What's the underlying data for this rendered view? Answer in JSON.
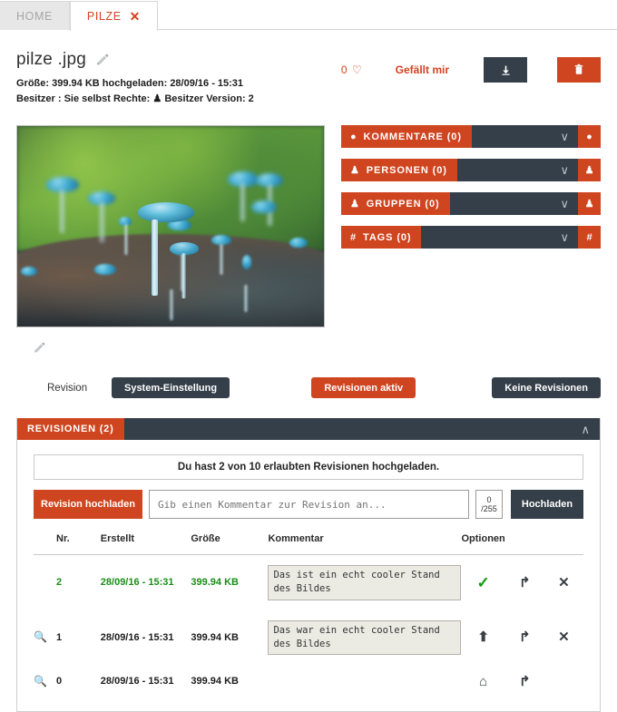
{
  "tabs": [
    {
      "label": "HOME",
      "active": false
    },
    {
      "label": "PILZE",
      "active": true,
      "close": "✕"
    }
  ],
  "file": {
    "title": "pilze .jpg",
    "meta_line1": "Größe: 399.94 KB  hochgeladen: 28/09/16 - 15:31",
    "meta_line2_a": "Besitzer : Sie selbst   Rechte:",
    "meta_line2_b": "Besitzer   Version: 2",
    "edit_icon": "pencil-icon"
  },
  "actions": {
    "like_count": "0",
    "heart_icon": "♡",
    "like_label": "Gefällt mir",
    "download_icon": "⬇",
    "delete_icon": "🗑"
  },
  "panels": [
    {
      "title": "KOMMENTARE (0)",
      "icon": "●",
      "icon_name": "comment-icon",
      "action_icon": "●",
      "chevron": "∨"
    },
    {
      "title": "PERSONEN (0)",
      "icon": "♟",
      "icon_name": "person-icon",
      "action_icon": "♟",
      "chevron": "∨"
    },
    {
      "title": "GRUPPEN (0)",
      "icon": "♟",
      "icon_name": "group-icon",
      "action_icon": "♟",
      "chevron": "∨"
    },
    {
      "title": "TAGS (0)",
      "icon": "#",
      "icon_name": "hash-icon",
      "action_icon": "#",
      "chevron": "∨"
    }
  ],
  "revision_settings": {
    "label": "Revision",
    "system_btn": "System-Einstellung",
    "active_btn": "Revisionen aktiv",
    "none_btn": "Keine Revisionen"
  },
  "revisions": {
    "header": "REVISIONEN (2)",
    "collapse_icon": "∧",
    "notice": "Du hast 2 von 10 erlaubten Revisionen hochgeladen.",
    "upload_btn": "Revision hochladen",
    "comment_placeholder": "Gib einen Kommentar zur Revision an...",
    "counter_current": "0",
    "counter_max": "/255",
    "submit_btn": "Hochladen",
    "columns": [
      "Nr.",
      "Erstellt",
      "Größe",
      "Kommentar",
      "Optionen"
    ],
    "rows": [
      {
        "zoom": "",
        "nr": "2",
        "created": "28/09/16 - 15:31",
        "size": "399.94 KB",
        "comment": "Das ist ein echt cooler Stand des Bildes",
        "highlight": true,
        "opt1": "✓",
        "opt1_name": "current-revision-check-icon",
        "opt2": "↱",
        "opt2_name": "restore-revision-icon",
        "opt3": "✕",
        "opt3_name": "delete-revision-icon"
      },
      {
        "zoom": "🔍",
        "nr": "1",
        "created": "28/09/16 - 15:31",
        "size": "399.94 KB",
        "comment": "Das war ein echt cooler Stand des Bildes",
        "highlight": false,
        "opt1": "⬆",
        "opt1_name": "promote-revision-icon",
        "opt2": "↱",
        "opt2_name": "restore-revision-icon",
        "opt3": "✕",
        "opt3_name": "delete-revision-icon"
      },
      {
        "zoom": "🔍",
        "nr": "0",
        "created": "28/09/16 - 15:31",
        "size": "399.94 KB",
        "comment": "",
        "highlight": false,
        "opt1": "⌂",
        "opt1_name": "original-revision-home-icon",
        "opt2": "↱",
        "opt2_name": "restore-revision-icon",
        "opt3": "",
        "opt3_name": "no-action"
      }
    ]
  },
  "colors": {
    "accent_orange": "#cf4520",
    "dark_slate": "#343f49",
    "green": "#1a8c1a"
  }
}
